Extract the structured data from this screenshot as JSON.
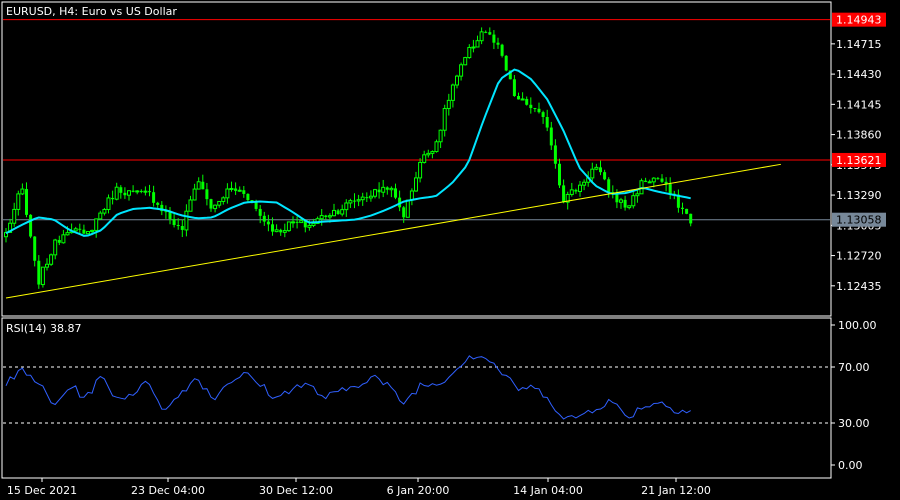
{
  "chart_data": [
    {
      "type": "candlestick",
      "title": "EURUSD, H4:  Euro vs US Dollar",
      "colors": {
        "background": "#000000",
        "candle": "#00ff00",
        "ma": "#00e5ff",
        "trendline": "#ffff00",
        "resistance": "#ff0000",
        "current": "#778899",
        "axis": "#ffffff"
      },
      "ylim": [
        1.1216,
        1.151
      ],
      "yticks": [
        "1.14715",
        "1.14430",
        "1.14145",
        "1.13860",
        "1.13575",
        "1.13290",
        "1.13005",
        "1.12720",
        "1.12435"
      ],
      "xticks": [
        "15 Dec 2021",
        "23 Dec 04:00",
        "30 Dec 12:00",
        "6 Jan 20:00",
        "14 Jan 04:00",
        "21 Jan 12:00"
      ],
      "price_levels": [
        {
          "value": 1.14943,
          "label": "1.14943",
          "color": "#ff0000",
          "style": "solid"
        },
        {
          "value": 1.13621,
          "label": "1.13621",
          "color": "#ff0000",
          "style": "solid"
        },
        {
          "value": 1.13058,
          "label": "1.13058",
          "color": "#778899",
          "style": "solid"
        }
      ],
      "trendline": {
        "from": {
          "bar": 0,
          "price": 1.1232
        },
        "to": {
          "bar": 189,
          "price": 1.1358
        }
      },
      "ma_anchors": [
        1.1293,
        1.1301,
        1.1308,
        1.1306,
        1.1296,
        1.129,
        1.1296,
        1.1311,
        1.1316,
        1.1317,
        1.1315,
        1.131,
        1.1307,
        1.1308,
        1.1316,
        1.1322,
        1.1323,
        1.1322,
        1.1313,
        1.1303,
        1.1304,
        1.1305,
        1.1306,
        1.131,
        1.1316,
        1.1323,
        1.1326,
        1.1328,
        1.134,
        1.1358,
        1.14,
        1.1438,
        1.1448,
        1.1438,
        1.1419,
        1.139,
        1.1355,
        1.1338,
        1.133,
        1.1331,
        1.1336,
        1.1332,
        1.1329,
        1.1326
      ],
      "price_anchors": [
        1.1293,
        1.1336,
        1.1246,
        1.1281,
        1.13,
        1.1289,
        1.1314,
        1.1335,
        1.133,
        1.133,
        1.1313,
        1.1294,
        1.1345,
        1.1314,
        1.1335,
        1.1332,
        1.1309,
        1.1294,
        1.1303,
        1.13,
        1.131,
        1.1316,
        1.1325,
        1.133,
        1.1338,
        1.131,
        1.136,
        1.1378,
        1.143,
        1.1462,
        1.1486,
        1.1465,
        1.142,
        1.1412,
        1.1395,
        1.1325,
        1.1337,
        1.1356,
        1.133,
        1.1317,
        1.1342,
        1.1345,
        1.1325,
        1.1305
      ]
    },
    {
      "type": "line",
      "title": "RSI(14) 38.87",
      "ylim": [
        0,
        100
      ],
      "yticks": [
        "100.00",
        "70.00",
        "30.00",
        "0.00"
      ],
      "levels": [
        70,
        30
      ],
      "color": "#3060ff",
      "anchors": [
        58,
        67,
        60,
        41,
        57,
        48,
        63,
        47,
        52,
        59,
        38,
        52,
        63,
        47,
        60,
        65,
        57,
        47,
        56,
        57,
        48,
        52,
        57,
        64,
        56,
        44,
        57,
        58,
        65,
        78,
        78,
        68,
        55,
        55,
        50,
        32,
        35,
        41,
        46,
        34,
        42,
        45,
        40,
        38.87
      ]
    }
  ]
}
